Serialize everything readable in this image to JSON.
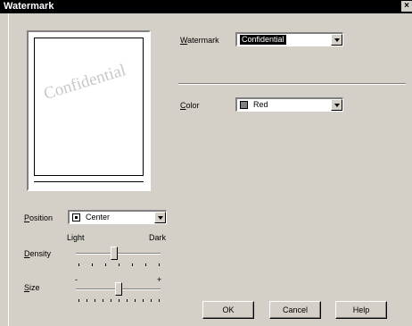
{
  "window": {
    "title": "Watermark",
    "close_glyph": "×"
  },
  "preview": {
    "watermark_text": "Confidential"
  },
  "watermark": {
    "label_accel": "W",
    "label_rest": "atermark",
    "value": "Confidential"
  },
  "color": {
    "label_accel": "C",
    "label_rest": "olor",
    "value": "Red",
    "swatch_hex": "#808080"
  },
  "position": {
    "label_accel": "P",
    "label_rest": "osition",
    "value": "Center"
  },
  "density": {
    "label_accel": "D",
    "label_rest": "ensity",
    "min_label": "Light",
    "max_label": "Dark",
    "level": 0.45
  },
  "size": {
    "label_accel": "S",
    "label_rest": "ize",
    "min_label": "-",
    "max_label": "+",
    "level": 0.5
  },
  "buttons": {
    "ok": "OK",
    "cancel": "Cancel",
    "help": "Help"
  }
}
